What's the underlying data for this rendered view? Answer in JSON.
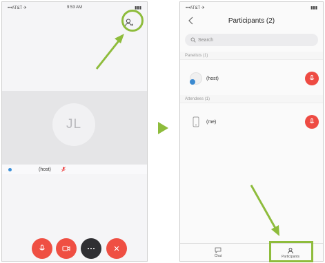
{
  "screen1": {
    "status": {
      "left": "•••AT&T ✈",
      "center": "9:53 AM",
      "right": "▮▮▮"
    },
    "avatar_initials": "JL",
    "self_name": "(host)",
    "controls": [
      "mute",
      "video",
      "more",
      "end"
    ]
  },
  "screen2": {
    "status": {
      "left": "•••AT&T ✈",
      "center": "",
      "right": "▮▮▮"
    },
    "title": "Participants (2)",
    "search_placeholder": "Search",
    "sections": [
      {
        "label": "Panelists (1)",
        "row": {
          "name": "(host)"
        }
      },
      {
        "label": "Attendees (1)",
        "row": {
          "name": "(me)"
        }
      }
    ],
    "tabs": [
      {
        "label": "Chat"
      },
      {
        "label": "Participants"
      }
    ]
  },
  "colors": {
    "accent_green": "#8ebc3c",
    "action_red": "#ef4f43",
    "dark_button": "#2f2f33",
    "presence_blue": "#3a8fd8"
  }
}
